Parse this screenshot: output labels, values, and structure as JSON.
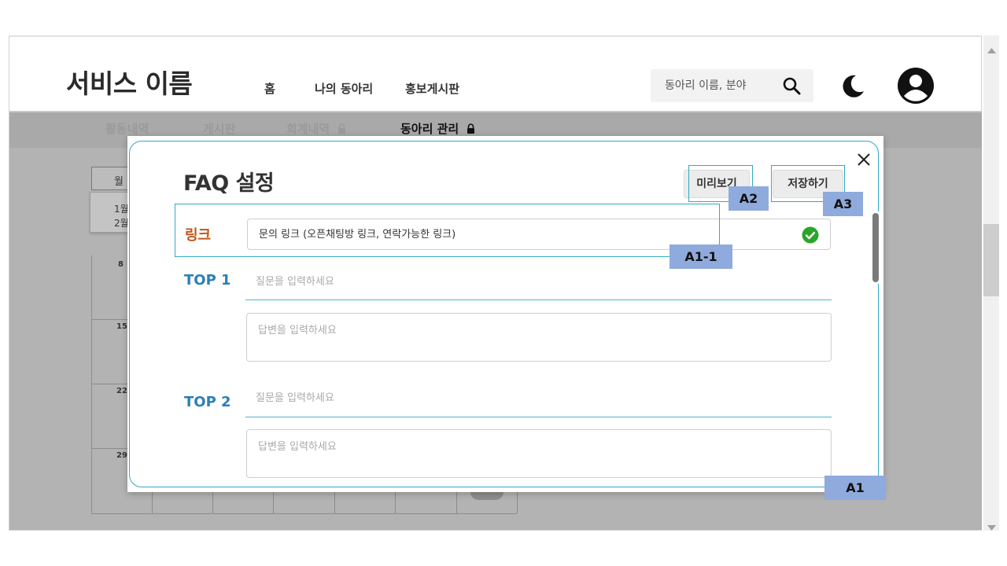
{
  "header": {
    "brand": "서비스 이름",
    "nav": [
      "홈",
      "나의 동아리",
      "홍보게시판"
    ],
    "search_placeholder": "동아리 이름, 분야",
    "icons": {
      "search": "search-icon",
      "theme": "moon-icon",
      "profile": "account-circle-icon"
    }
  },
  "subnav": {
    "items": [
      "활동내역",
      "게시판",
      "회계내역",
      "동아리 관리"
    ],
    "lock_icon": "lock-icon"
  },
  "calendar": {
    "month_button": "월",
    "month_options": [
      "1월",
      "2월"
    ],
    "week_start_days": [
      "8",
      "15",
      "22",
      "29"
    ]
  },
  "modal": {
    "title": "FAQ 설정",
    "preview_button": "미리보기",
    "save_button": "저장하기",
    "link_label": "링크",
    "link_placeholder": "문의 링크 (오픈채팅방 링크, 연락가능한 링크)",
    "link_status_icon": "check-circle-icon",
    "faq": [
      {
        "label": "TOP 1",
        "question_placeholder": "질문을 입력하세요",
        "answer_placeholder": "답변을 입력하세요"
      },
      {
        "label": "TOP 2",
        "question_placeholder": "질문을 입력하세요",
        "answer_placeholder": "답변을 입력하세요"
      }
    ],
    "close_icon": "close-icon"
  },
  "annotations": {
    "a1": "A1",
    "a1_1": "A1-1",
    "a2": "A2",
    "a3": "A3"
  },
  "colors": {
    "accent_outline": "#31a9c8",
    "link_label": "#c0561a",
    "top_label": "#2a7fb7",
    "annotation_tag": "#8faadc",
    "check": "#2aa52a"
  }
}
